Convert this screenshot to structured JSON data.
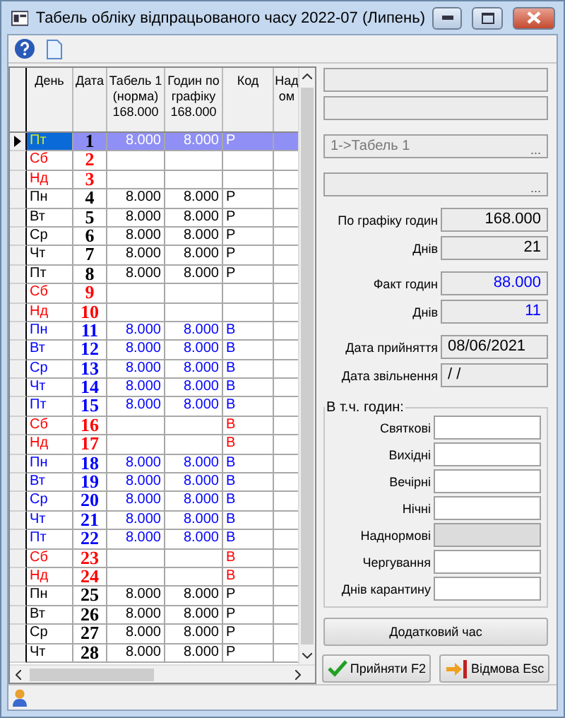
{
  "window": {
    "title": "Табель обліку відпрацьованого часу 2022-07 (Липень)"
  },
  "table": {
    "columns": [
      {
        "lines": [
          "День"
        ]
      },
      {
        "lines": [
          "Дата"
        ]
      },
      {
        "lines": [
          "Табель 1",
          "(норма)",
          "168.000"
        ]
      },
      {
        "lines": [
          "Годин по",
          "графіку",
          "168.000"
        ]
      },
      {
        "lines": [
          "Код"
        ]
      },
      {
        "lines": [
          "Над",
          "ом"
        ]
      }
    ],
    "rows": [
      {
        "day": "Пт",
        "date": "1",
        "tabel": "8.000",
        "hours": "8.000",
        "code": "Р",
        "color": "#000000",
        "selected": true
      },
      {
        "day": "Сб",
        "date": "2",
        "tabel": "",
        "hours": "",
        "code": "",
        "color": "#ff0000",
        "selected": false
      },
      {
        "day": "Нд",
        "date": "3",
        "tabel": "",
        "hours": "",
        "code": "",
        "color": "#ff0000",
        "selected": false
      },
      {
        "day": "Пн",
        "date": "4",
        "tabel": "8.000",
        "hours": "8.000",
        "code": "Р",
        "color": "#000000",
        "selected": false
      },
      {
        "day": "Вт",
        "date": "5",
        "tabel": "8.000",
        "hours": "8.000",
        "code": "Р",
        "color": "#000000",
        "selected": false
      },
      {
        "day": "Ср",
        "date": "6",
        "tabel": "8.000",
        "hours": "8.000",
        "code": "Р",
        "color": "#000000",
        "selected": false
      },
      {
        "day": "Чт",
        "date": "7",
        "tabel": "8.000",
        "hours": "8.000",
        "code": "Р",
        "color": "#000000",
        "selected": false
      },
      {
        "day": "Пт",
        "date": "8",
        "tabel": "8.000",
        "hours": "8.000",
        "code": "Р",
        "color": "#000000",
        "selected": false
      },
      {
        "day": "Сб",
        "date": "9",
        "tabel": "",
        "hours": "",
        "code": "",
        "color": "#ff0000",
        "selected": false
      },
      {
        "day": "Нд",
        "date": "10",
        "tabel": "",
        "hours": "",
        "code": "",
        "color": "#ff0000",
        "selected": false
      },
      {
        "day": "Пн",
        "date": "11",
        "tabel": "8.000",
        "hours": "8.000",
        "code": "В",
        "color": "#0000ff",
        "selected": false
      },
      {
        "day": "Вт",
        "date": "12",
        "tabel": "8.000",
        "hours": "8.000",
        "code": "В",
        "color": "#0000ff",
        "selected": false
      },
      {
        "day": "Ср",
        "date": "13",
        "tabel": "8.000",
        "hours": "8.000",
        "code": "В",
        "color": "#0000ff",
        "selected": false
      },
      {
        "day": "Чт",
        "date": "14",
        "tabel": "8.000",
        "hours": "8.000",
        "code": "В",
        "color": "#0000ff",
        "selected": false
      },
      {
        "day": "Пт",
        "date": "15",
        "tabel": "8.000",
        "hours": "8.000",
        "code": "В",
        "color": "#0000ff",
        "selected": false
      },
      {
        "day": "Сб",
        "date": "16",
        "tabel": "",
        "hours": "",
        "code": "В",
        "color": "#ff0000",
        "selected": false
      },
      {
        "day": "Нд",
        "date": "17",
        "tabel": "",
        "hours": "",
        "code": "В",
        "color": "#ff0000",
        "selected": false
      },
      {
        "day": "Пн",
        "date": "18",
        "tabel": "8.000",
        "hours": "8.000",
        "code": "В",
        "color": "#0000ff",
        "selected": false
      },
      {
        "day": "Вт",
        "date": "19",
        "tabel": "8.000",
        "hours": "8.000",
        "code": "В",
        "color": "#0000ff",
        "selected": false
      },
      {
        "day": "Ср",
        "date": "20",
        "tabel": "8.000",
        "hours": "8.000",
        "code": "В",
        "color": "#0000ff",
        "selected": false
      },
      {
        "day": "Чт",
        "date": "21",
        "tabel": "8.000",
        "hours": "8.000",
        "code": "В",
        "color": "#0000ff",
        "selected": false
      },
      {
        "day": "Пт",
        "date": "22",
        "tabel": "8.000",
        "hours": "8.000",
        "code": "В",
        "color": "#0000ff",
        "selected": false
      },
      {
        "day": "Сб",
        "date": "23",
        "tabel": "",
        "hours": "",
        "code": "В",
        "color": "#ff0000",
        "selected": false
      },
      {
        "day": "Нд",
        "date": "24",
        "tabel": "",
        "hours": "",
        "code": "В",
        "color": "#ff0000",
        "selected": false
      },
      {
        "day": "Пн",
        "date": "25",
        "tabel": "8.000",
        "hours": "8.000",
        "code": "Р",
        "color": "#000000",
        "selected": false
      },
      {
        "day": "Вт",
        "date": "26",
        "tabel": "8.000",
        "hours": "8.000",
        "code": "Р",
        "color": "#000000",
        "selected": false
      },
      {
        "day": "Ср",
        "date": "27",
        "tabel": "8.000",
        "hours": "8.000",
        "code": "Р",
        "color": "#000000",
        "selected": false
      },
      {
        "day": "Чт",
        "date": "28",
        "tabel": "8.000",
        "hours": "8.000",
        "code": "Р",
        "color": "#000000",
        "selected": false
      }
    ]
  },
  "panel": {
    "selector": "1->Табель 1",
    "ellipsis": [
      "...",
      "..."
    ],
    "summary": [
      [
        {
          "label": "По графіку годин",
          "value": "168.000",
          "color": "#000000"
        },
        {
          "label": "Днів",
          "value": "21",
          "color": "#000000"
        }
      ],
      [
        {
          "label": "Факт годин",
          "value": "88.000",
          "color": "#0000ff"
        },
        {
          "label": "Днів",
          "value": "11",
          "color": "#0000ff"
        }
      ],
      [
        {
          "label": "Дата прийняття",
          "value": "08/06/2021",
          "color": "#000000"
        },
        {
          "label": "Дата звільнення",
          "value": "/ /",
          "color": "#000000"
        }
      ]
    ],
    "hours_group": {
      "title": "В т.ч. годин:",
      "fields": [
        {
          "label": "Святкові",
          "disabled": false
        },
        {
          "label": "Вихідні",
          "disabled": false
        },
        {
          "label": "Вечірні",
          "disabled": false
        },
        {
          "label": "Нічні",
          "disabled": false
        },
        {
          "label": "Наднормові",
          "disabled": true
        },
        {
          "label": "Чергування",
          "disabled": false
        },
        {
          "label": "Днів карантину",
          "disabled": false
        }
      ]
    },
    "extra_button": "Додатковий час",
    "buttons": [
      {
        "kind": "accept",
        "label": "Прийняти F2"
      },
      {
        "kind": "cancel",
        "label": "Відмова Esc"
      }
    ]
  }
}
